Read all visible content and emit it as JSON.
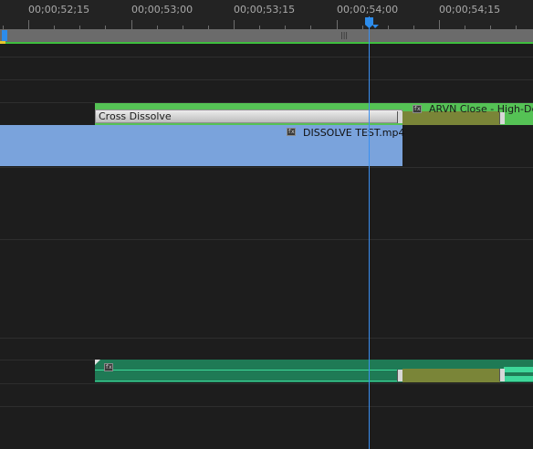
{
  "ruler": {
    "timecodes": [
      "00;00;52;15",
      "00;00;53;00",
      "00;00;53;15",
      "00;00;54;00",
      "00;00;54;15"
    ]
  },
  "workbar": {
    "grip_glyph": "|||"
  },
  "tracks": {
    "v2_transition": {
      "label": "Cross Dissolve",
      "color": "#c8c8c8"
    },
    "v2_clip": {
      "label": "ARVN Close - High-De",
      "color": "#55c255",
      "fx": "fx"
    },
    "v1_clip": {
      "label": "DISSOLVE TEST.mp4",
      "color": "#7aa3dc",
      "fx": "fx"
    },
    "a1_clip": {
      "color": "#1f7a55",
      "fx": "fx"
    },
    "overlap_color": "#7a8538"
  },
  "colors": {
    "background": "#1d1d1d",
    "playhead": "#3a8ff0",
    "work_area": "#3fbe3f",
    "in_point": "#e8c52c"
  },
  "icons": {
    "playhead": "playhead-marker-icon",
    "fx": "fx-badge-icon",
    "edge": "clip-edge-icon"
  }
}
